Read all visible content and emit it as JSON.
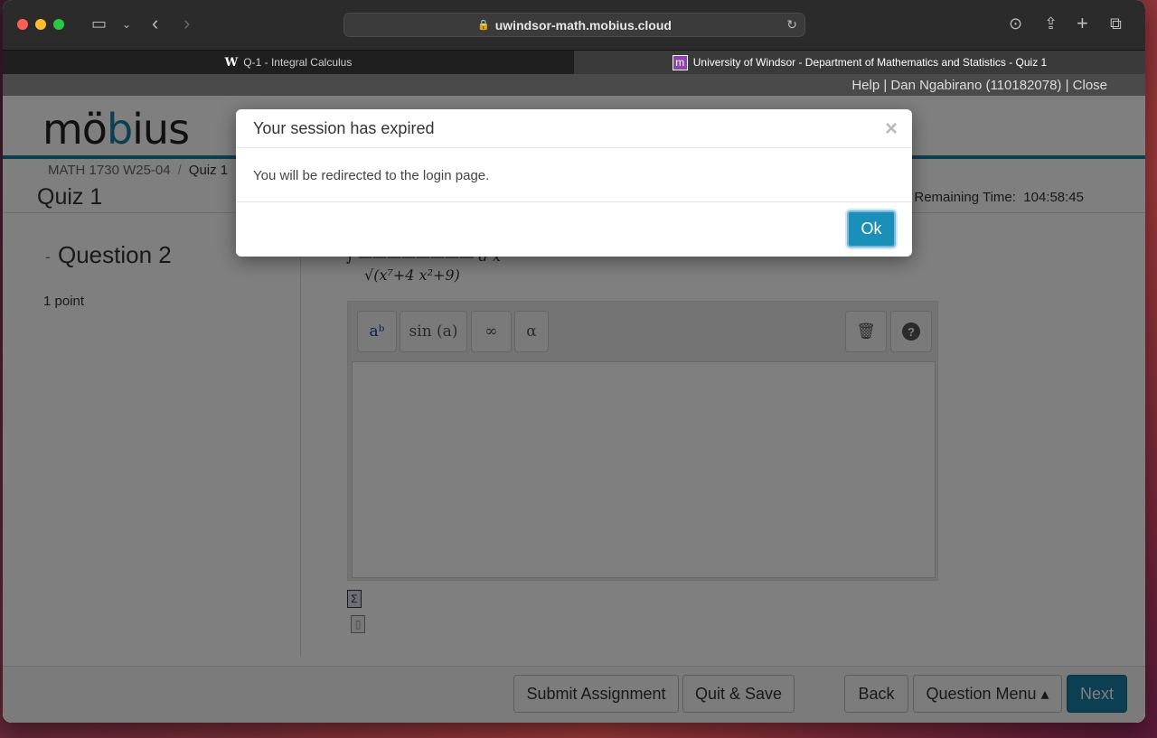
{
  "browser": {
    "url": "uwindsor-math.mobius.cloud",
    "tabs": [
      {
        "label": "Q-1 - Integral Calculus",
        "favicon": "W"
      },
      {
        "label": "University of Windsor - Department of Mathematics and Statistics - Quiz 1",
        "favicon": "m"
      }
    ]
  },
  "userbar": {
    "text": "Help | Dan Ngabirano (110182078) | Close"
  },
  "logo": {
    "part1": "mö",
    "part2": "b",
    "part3": "ius"
  },
  "breadcrumb": {
    "course": "MATH 1730 W25-04",
    "sep": "/",
    "current": "Quiz 1"
  },
  "quiz": {
    "title": "Quiz 1",
    "remaining_label": "Remaining Time:",
    "remaining_time": "104:58:45"
  },
  "question": {
    "minus": "-",
    "title": "Question 2",
    "points": "1 point",
    "expression": "∫ ———————— d x",
    "denominator": "√(x⁷+4 x²+9)"
  },
  "editor": {
    "btn_power": "aᵇ",
    "btn_sin": "sin (a)",
    "btn_inf": "∞",
    "btn_alpha": "α",
    "btn_help": "?"
  },
  "footer": {
    "submit": "Submit Assignment",
    "quit_save": "Quit & Save",
    "back": "Back",
    "question_menu": "Question Menu ▴",
    "next": "Next"
  },
  "modal": {
    "title": "Your session has expired",
    "close": "×",
    "body": "You will be redirected to the login page.",
    "ok": "Ok"
  }
}
